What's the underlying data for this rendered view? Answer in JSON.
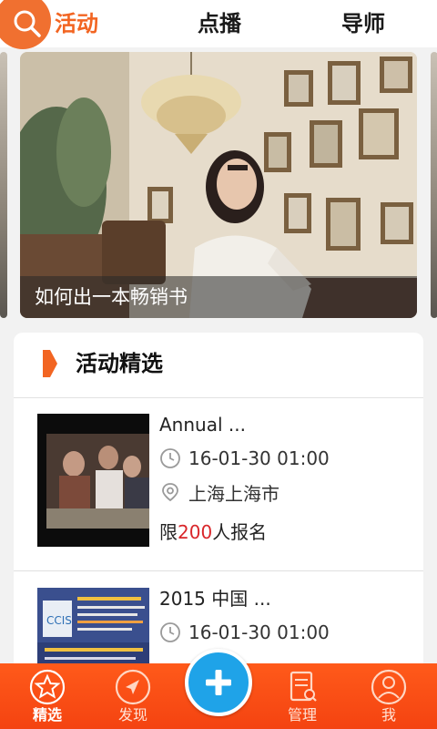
{
  "header": {
    "tabs": [
      {
        "label": "活动",
        "active": true
      },
      {
        "label": "点播",
        "active": false
      },
      {
        "label": "导师",
        "active": false
      }
    ],
    "search_icon": "search-icon",
    "accent_color": "#f26522"
  },
  "banner": {
    "caption": "如何出一本畅销书"
  },
  "featured": {
    "title": "活动精选",
    "events": [
      {
        "title": "Annual ...",
        "time": "16-01-30 01:00",
        "location": "上海上海市",
        "limit_prefix": "限",
        "limit_count": "200",
        "limit_suffix": "人报名"
      },
      {
        "title": "2015 中国 ...",
        "time": "16-01-30 01:00"
      }
    ]
  },
  "bottom_nav": {
    "items": [
      {
        "label": "精选",
        "icon": "star-icon",
        "active": true
      },
      {
        "label": "发现",
        "icon": "compass-icon",
        "active": false
      },
      {
        "label": "管理",
        "icon": "document-search-icon",
        "active": false
      },
      {
        "label": "我",
        "icon": "user-icon",
        "active": false
      }
    ],
    "fab_icon": "plus-icon",
    "bar_color": "#f44311",
    "fab_color": "#1fa3e8"
  }
}
